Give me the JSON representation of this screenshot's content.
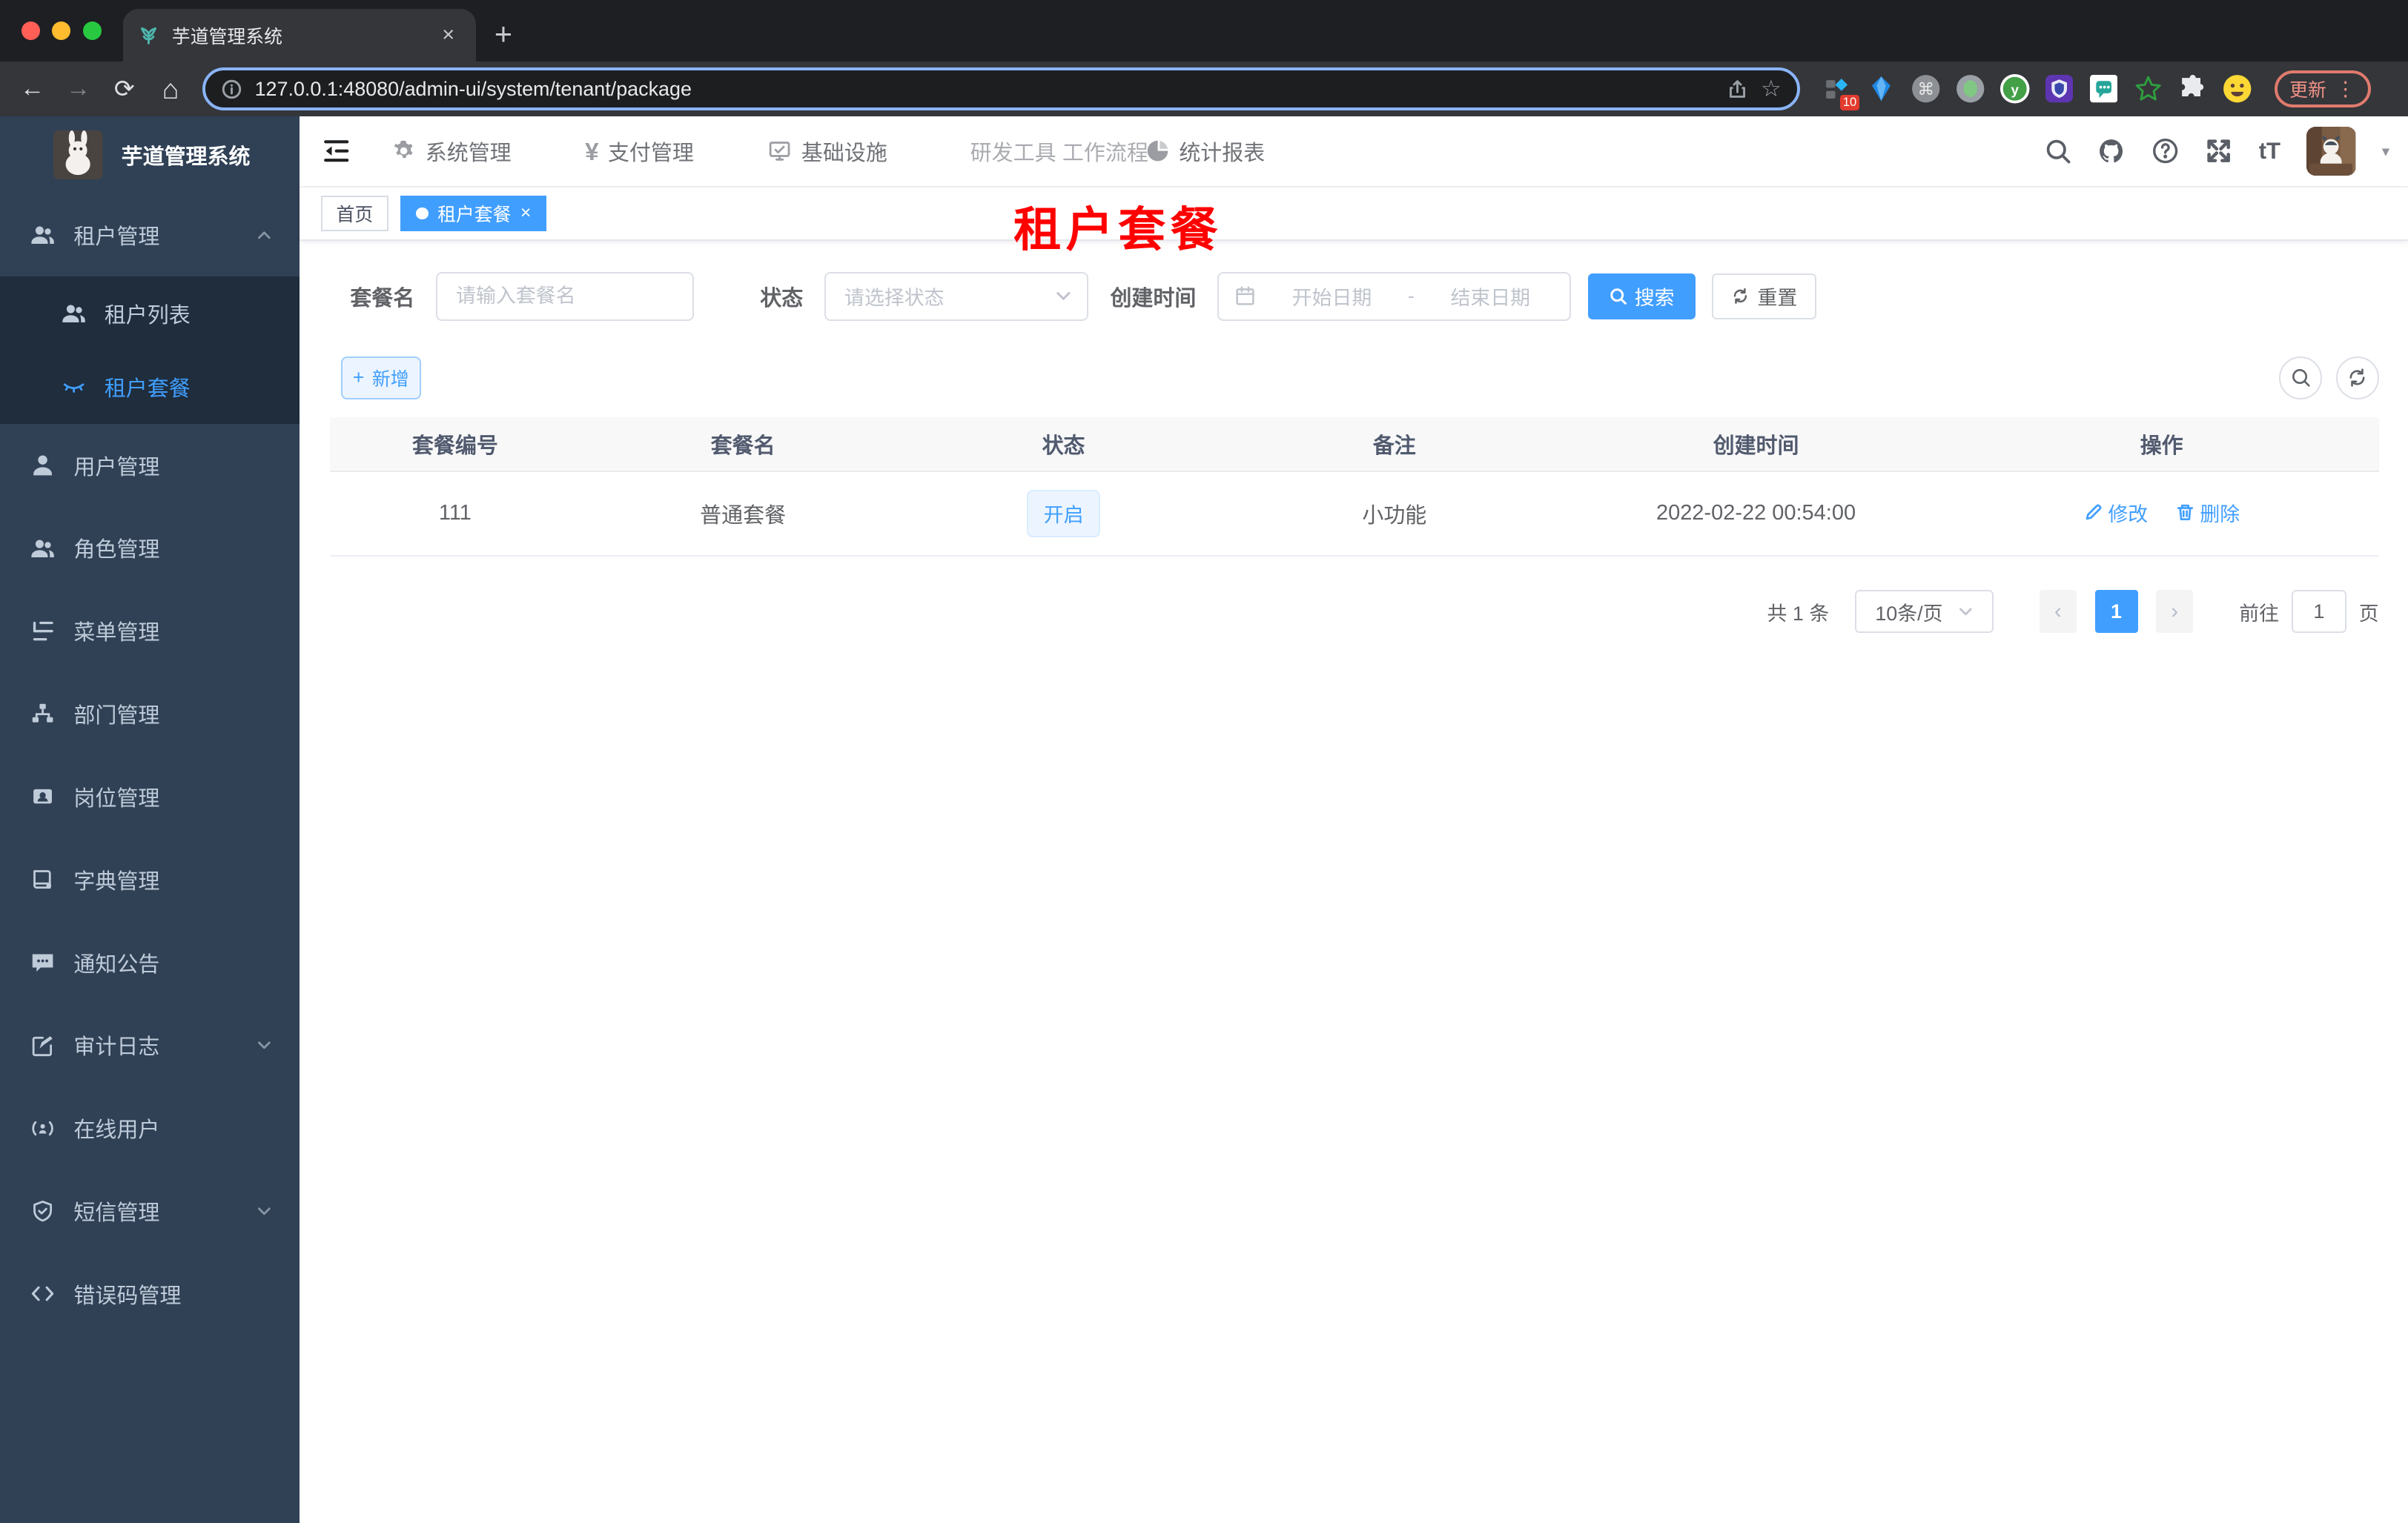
{
  "colors": {
    "primary": "#409eff",
    "annotation_red": "#ff0000",
    "sidebar_bg": "#304156",
    "submenu_bg": "#1f2d3d",
    "update_pill": "#f29287"
  },
  "browser": {
    "tab_title": "芋道管理系统",
    "tab_close": "×",
    "new_tab": "+",
    "back": "←",
    "forward": "→",
    "reload": "⟳",
    "home": "⌂",
    "url": "127.0.0.1:48080/admin-ui/system/tenant/package",
    "bookmark_star": "☆",
    "extension_badge": "10",
    "cmd_glyph": "⌘",
    "y_glyph": "y",
    "update_label": "更新",
    "kebab": "⋮"
  },
  "sidebar": {
    "logo_title": "芋道管理系统",
    "items": [
      {
        "label": "租户管理"
      },
      {
        "label": "租户列表"
      },
      {
        "label": "租户套餐"
      },
      {
        "label": "用户管理"
      },
      {
        "label": "角色管理"
      },
      {
        "label": "菜单管理"
      },
      {
        "label": "部门管理"
      },
      {
        "label": "岗位管理"
      },
      {
        "label": "字典管理"
      },
      {
        "label": "通知公告"
      },
      {
        "label": "审计日志"
      },
      {
        "label": "在线用户"
      },
      {
        "label": "短信管理"
      },
      {
        "label": "错误码管理"
      }
    ]
  },
  "topnav": {
    "items": [
      {
        "label": "系统管理"
      },
      {
        "label": "支付管理"
      },
      {
        "label": "基础设施"
      },
      {
        "label": "研发工具"
      },
      {
        "label": "工作流程"
      },
      {
        "label": "统计报表"
      }
    ],
    "fontsize_glyph": "tT",
    "caret": "▾"
  },
  "tags": {
    "home": "首页",
    "active": "租户套餐",
    "close": "×"
  },
  "annotation": "租户套餐",
  "form": {
    "name_label": "套餐名",
    "name_placeholder": "请输入套餐名",
    "status_label": "状态",
    "status_placeholder": "请选择状态",
    "date_label": "创建时间",
    "date_start": "开始日期",
    "date_sep": "-",
    "date_end": "结束日期",
    "search": "搜索",
    "reset": "重置"
  },
  "toolbar": {
    "add": "新增",
    "plus": "+"
  },
  "table": {
    "headers": [
      "套餐编号",
      "套餐名",
      "状态",
      "备注",
      "创建时间",
      "操作"
    ],
    "rows": [
      {
        "id": "111",
        "name": "普通套餐",
        "status": "开启",
        "remark": "小功能",
        "created": "2022-02-22 00:54:00",
        "edit": "修改",
        "delete": "删除"
      }
    ]
  },
  "pagination": {
    "total": "共 1 条",
    "page_size": "10条/页",
    "prev": "‹",
    "current": "1",
    "next": "›",
    "goto": "前往",
    "page_value": "1",
    "unit": "页"
  }
}
